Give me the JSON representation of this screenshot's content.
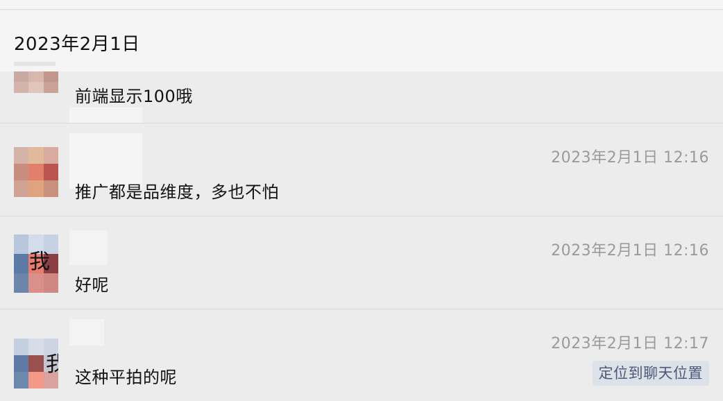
{
  "date_header": "2023年2月1日",
  "messages": [
    {
      "text": "前端显示100哦",
      "time": ""
    },
    {
      "text": "推广都是品维度，多也不怕",
      "time": "2023年2月1日 12:16"
    },
    {
      "avatar_label": "我",
      "text": "好呢",
      "time": "2023年2月1日 12:16"
    },
    {
      "avatar_label": "我",
      "text": "这种平拍的呢",
      "time": "2023年2月1日 12:17",
      "action_label": "定位到聊天位置"
    }
  ],
  "colors": {
    "background": "#ececec",
    "header_background": "#f5f5f5",
    "time_text": "#9a9a9a",
    "action_button_bg": "#dde1e8",
    "action_button_text": "#4a5a78"
  }
}
